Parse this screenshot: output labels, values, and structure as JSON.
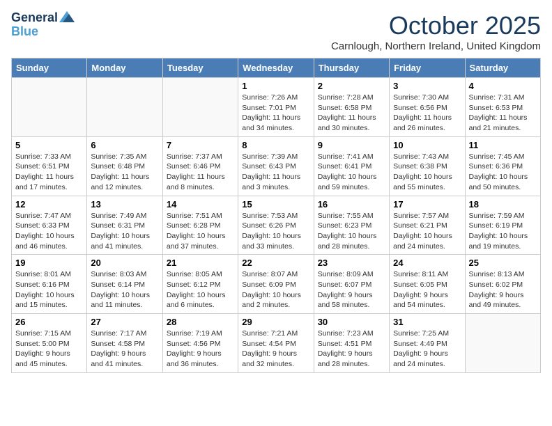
{
  "logo": {
    "line1": "General",
    "line2": "Blue"
  },
  "title": "October 2025",
  "location": "Carnlough, Northern Ireland, United Kingdom",
  "days_of_week": [
    "Sunday",
    "Monday",
    "Tuesday",
    "Wednesday",
    "Thursday",
    "Friday",
    "Saturday"
  ],
  "weeks": [
    [
      {
        "day": "",
        "content": ""
      },
      {
        "day": "",
        "content": ""
      },
      {
        "day": "",
        "content": ""
      },
      {
        "day": "1",
        "content": "Sunrise: 7:26 AM\nSunset: 7:01 PM\nDaylight: 11 hours\nand 34 minutes."
      },
      {
        "day": "2",
        "content": "Sunrise: 7:28 AM\nSunset: 6:58 PM\nDaylight: 11 hours\nand 30 minutes."
      },
      {
        "day": "3",
        "content": "Sunrise: 7:30 AM\nSunset: 6:56 PM\nDaylight: 11 hours\nand 26 minutes."
      },
      {
        "day": "4",
        "content": "Sunrise: 7:31 AM\nSunset: 6:53 PM\nDaylight: 11 hours\nand 21 minutes."
      }
    ],
    [
      {
        "day": "5",
        "content": "Sunrise: 7:33 AM\nSunset: 6:51 PM\nDaylight: 11 hours\nand 17 minutes."
      },
      {
        "day": "6",
        "content": "Sunrise: 7:35 AM\nSunset: 6:48 PM\nDaylight: 11 hours\nand 12 minutes."
      },
      {
        "day": "7",
        "content": "Sunrise: 7:37 AM\nSunset: 6:46 PM\nDaylight: 11 hours\nand 8 minutes."
      },
      {
        "day": "8",
        "content": "Sunrise: 7:39 AM\nSunset: 6:43 PM\nDaylight: 11 hours\nand 3 minutes."
      },
      {
        "day": "9",
        "content": "Sunrise: 7:41 AM\nSunset: 6:41 PM\nDaylight: 10 hours\nand 59 minutes."
      },
      {
        "day": "10",
        "content": "Sunrise: 7:43 AM\nSunset: 6:38 PM\nDaylight: 10 hours\nand 55 minutes."
      },
      {
        "day": "11",
        "content": "Sunrise: 7:45 AM\nSunset: 6:36 PM\nDaylight: 10 hours\nand 50 minutes."
      }
    ],
    [
      {
        "day": "12",
        "content": "Sunrise: 7:47 AM\nSunset: 6:33 PM\nDaylight: 10 hours\nand 46 minutes."
      },
      {
        "day": "13",
        "content": "Sunrise: 7:49 AM\nSunset: 6:31 PM\nDaylight: 10 hours\nand 41 minutes."
      },
      {
        "day": "14",
        "content": "Sunrise: 7:51 AM\nSunset: 6:28 PM\nDaylight: 10 hours\nand 37 minutes."
      },
      {
        "day": "15",
        "content": "Sunrise: 7:53 AM\nSunset: 6:26 PM\nDaylight: 10 hours\nand 33 minutes."
      },
      {
        "day": "16",
        "content": "Sunrise: 7:55 AM\nSunset: 6:23 PM\nDaylight: 10 hours\nand 28 minutes."
      },
      {
        "day": "17",
        "content": "Sunrise: 7:57 AM\nSunset: 6:21 PM\nDaylight: 10 hours\nand 24 minutes."
      },
      {
        "day": "18",
        "content": "Sunrise: 7:59 AM\nSunset: 6:19 PM\nDaylight: 10 hours\nand 19 minutes."
      }
    ],
    [
      {
        "day": "19",
        "content": "Sunrise: 8:01 AM\nSunset: 6:16 PM\nDaylight: 10 hours\nand 15 minutes."
      },
      {
        "day": "20",
        "content": "Sunrise: 8:03 AM\nSunset: 6:14 PM\nDaylight: 10 hours\nand 11 minutes."
      },
      {
        "day": "21",
        "content": "Sunrise: 8:05 AM\nSunset: 6:12 PM\nDaylight: 10 hours\nand 6 minutes."
      },
      {
        "day": "22",
        "content": "Sunrise: 8:07 AM\nSunset: 6:09 PM\nDaylight: 10 hours\nand 2 minutes."
      },
      {
        "day": "23",
        "content": "Sunrise: 8:09 AM\nSunset: 6:07 PM\nDaylight: 9 hours\nand 58 minutes."
      },
      {
        "day": "24",
        "content": "Sunrise: 8:11 AM\nSunset: 6:05 PM\nDaylight: 9 hours\nand 54 minutes."
      },
      {
        "day": "25",
        "content": "Sunrise: 8:13 AM\nSunset: 6:02 PM\nDaylight: 9 hours\nand 49 minutes."
      }
    ],
    [
      {
        "day": "26",
        "content": "Sunrise: 7:15 AM\nSunset: 5:00 PM\nDaylight: 9 hours\nand 45 minutes."
      },
      {
        "day": "27",
        "content": "Sunrise: 7:17 AM\nSunset: 4:58 PM\nDaylight: 9 hours\nand 41 minutes."
      },
      {
        "day": "28",
        "content": "Sunrise: 7:19 AM\nSunset: 4:56 PM\nDaylight: 9 hours\nand 36 minutes."
      },
      {
        "day": "29",
        "content": "Sunrise: 7:21 AM\nSunset: 4:54 PM\nDaylight: 9 hours\nand 32 minutes."
      },
      {
        "day": "30",
        "content": "Sunrise: 7:23 AM\nSunset: 4:51 PM\nDaylight: 9 hours\nand 28 minutes."
      },
      {
        "day": "31",
        "content": "Sunrise: 7:25 AM\nSunset: 4:49 PM\nDaylight: 9 hours\nand 24 minutes."
      },
      {
        "day": "",
        "content": ""
      }
    ]
  ]
}
